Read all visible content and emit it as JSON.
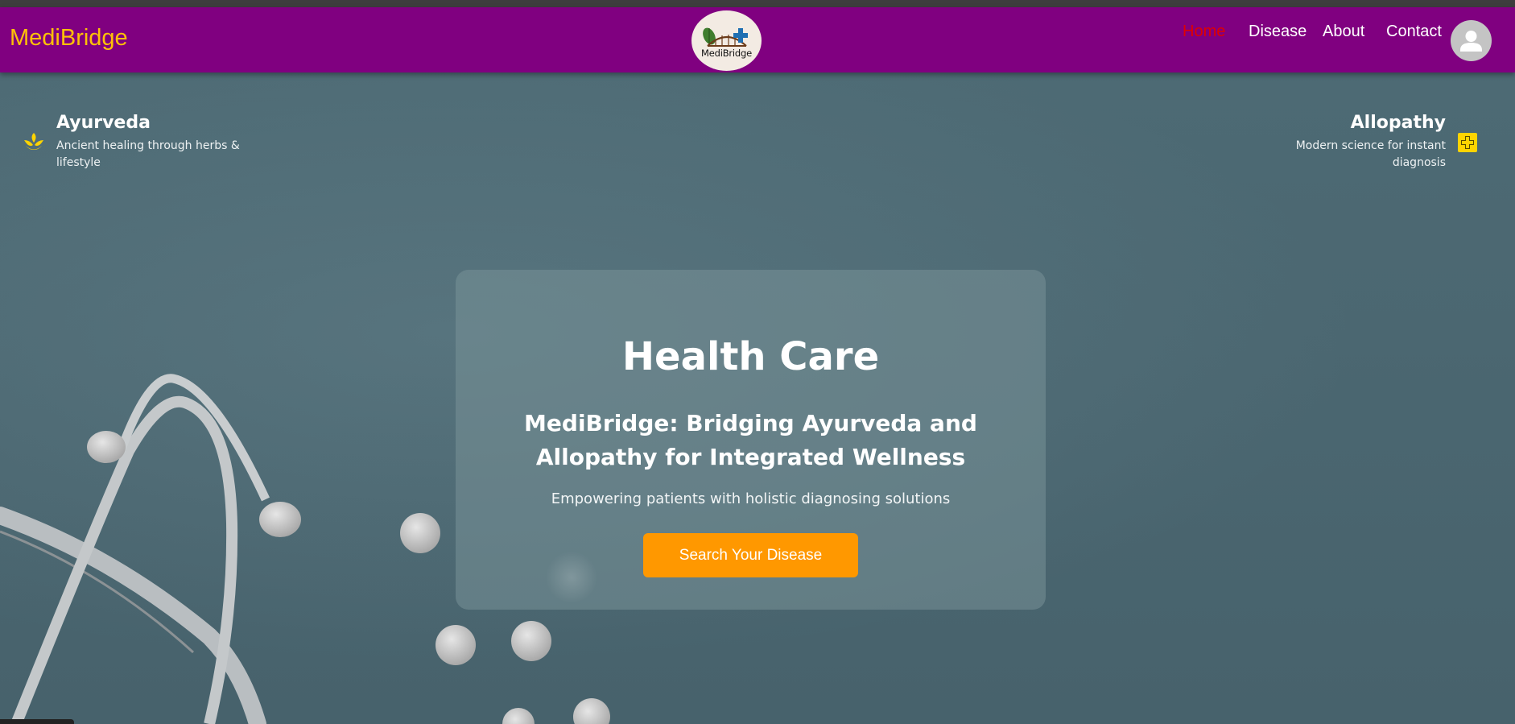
{
  "brand": {
    "name": "MediBridge",
    "color": "#ffc107"
  },
  "logo": {
    "text": "MediBridge"
  },
  "nav": {
    "items": [
      {
        "label": "Home",
        "active": true
      },
      {
        "label": "Disease",
        "active": false
      },
      {
        "label": "About",
        "active": false
      },
      {
        "label": "Contact",
        "active": false
      }
    ],
    "avatar_icon": "user-avatar-icon"
  },
  "features": {
    "left": {
      "title": "Ayurveda",
      "description": "Ancient healing through herbs & lifestyle",
      "icon": "leaf-icon"
    },
    "right": {
      "title": "Allopathy",
      "description": "Modern science for instant diagnosis",
      "icon": "medical-cross-icon"
    }
  },
  "hero": {
    "title": "Health Care",
    "subtitle": "MediBridge: Bridging Ayurveda and Allopathy for Integrated Wellness",
    "tagline": "Empowering patients with holistic diagnosing solutions",
    "cta_label": "Search Your Disease"
  },
  "colors": {
    "navbar": "#800080",
    "active_link": "#e00000",
    "accent_icon": "#ffd400",
    "cta": "#ff9800"
  }
}
